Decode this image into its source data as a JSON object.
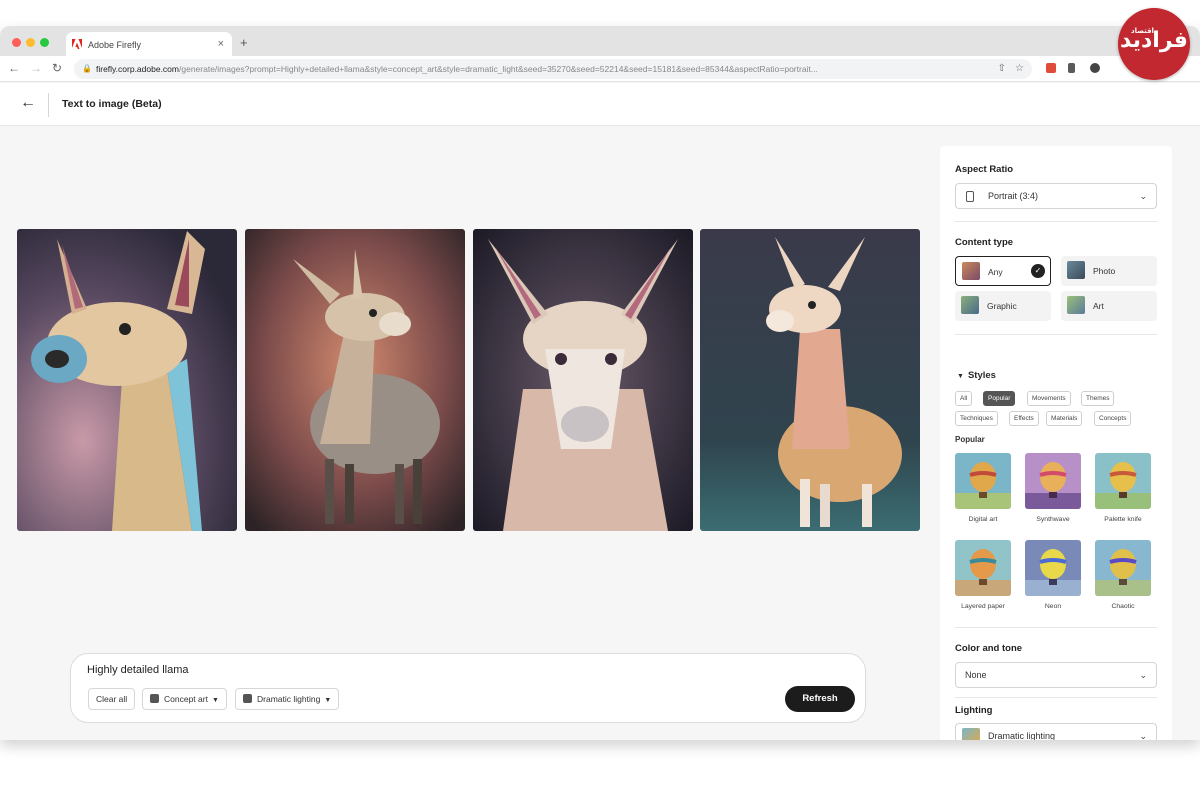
{
  "browser": {
    "tab_title": "Adobe Firefly",
    "url_domain": "firefly.corp.adobe.com",
    "url_path": "/generate/images?prompt=Highly+detailed+llama&style=concept_art&style=dramatic_light&seed=35270&seed=52214&seed=15181&seed=85344&aspectRatio=portrait..."
  },
  "header": {
    "title": "Text to image (Beta)"
  },
  "prompt": {
    "text": "Highly detailed llama",
    "clear_label": "Clear all",
    "chips": [
      "Concept art",
      "Dramatic lighting"
    ],
    "refresh_label": "Refresh"
  },
  "panel": {
    "aspect_title": "Aspect Ratio",
    "aspect_value": "Portrait (3:4)",
    "content_title": "Content type",
    "content_types": [
      {
        "label": "Any",
        "selected": true
      },
      {
        "label": "Photo",
        "selected": false
      },
      {
        "label": "Graphic",
        "selected": false
      },
      {
        "label": "Art",
        "selected": false
      }
    ],
    "styles_title": "Styles",
    "style_tabs": [
      "All",
      "Popular",
      "Movements",
      "Themes",
      "Techniques",
      "Effects",
      "Materials",
      "Concepts"
    ],
    "active_style_tab": "Popular",
    "popular_label": "Popular",
    "popular_styles": [
      "Digital art",
      "Synthwave",
      "Palette knife",
      "Layered paper",
      "Neon",
      "Chaotic"
    ],
    "color_title": "Color and tone",
    "color_value": "None",
    "lighting_title": "Lighting",
    "lighting_value": "Dramatic lighting"
  },
  "watermark": {
    "text": "فرادید",
    "sup": "اقتصاد"
  },
  "colors": {
    "accent_dark": "#1c1c1c",
    "window_bg": "#f6f6f6",
    "watermark_red": "#c1282f"
  }
}
